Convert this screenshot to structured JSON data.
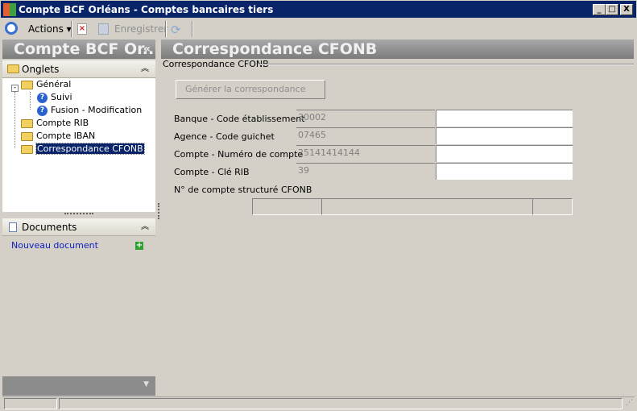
{
  "window": {
    "title": "Compte BCF Orléans -  Comptes bancaires tiers",
    "buttons": [
      "_",
      "□",
      "X"
    ]
  },
  "toolbar": {
    "actions": "Actions",
    "save": "Enregistrer"
  },
  "left": {
    "header": "Compte BCF Or..",
    "collapse": "«",
    "tabs_section": "Onglets",
    "tree": [
      {
        "label": "Général"
      },
      {
        "label": "Suivi"
      },
      {
        "label": "Fusion - Modification"
      },
      {
        "label": "Compte RIB"
      },
      {
        "label": "Compte IBAN"
      },
      {
        "label": "Correspondance CFONB"
      }
    ],
    "documents_section": "Documents",
    "new_document": "Nouveau document"
  },
  "main": {
    "header": "Correspondance CFONB",
    "group": "Correspondance CFONB",
    "generate_button": "Générer la correspondance",
    "fields": [
      {
        "label": "Banque - Code établissement",
        "value": "30002",
        "input": ""
      },
      {
        "label": "Agence - Code guichet",
        "value": "07465",
        "input": ""
      },
      {
        "label": "Compte - Numéro de compte",
        "value": "25141414144",
        "input": ""
      },
      {
        "label": "Compte - Clé RIB",
        "value": "39",
        "input": ""
      }
    ],
    "structured_label": "N° de compte structuré CFONB"
  }
}
